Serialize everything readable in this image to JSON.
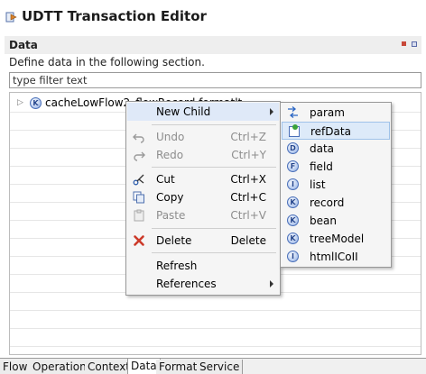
{
  "window": {
    "title": "UDTT Transaction Editor",
    "icon": "transaction-editor-icon"
  },
  "section": {
    "title": "Data",
    "description": "Define data in the following section."
  },
  "filter": {
    "placeholder": "type filter text"
  },
  "tree": {
    "node_label": "cacheLowFlow2_flowRecord.formatlt",
    "node_icon": "k-icon"
  },
  "context_menu": {
    "items": [
      {
        "label": "New Child",
        "accel": "",
        "icon": "",
        "has_submenu": true,
        "disabled": false
      },
      {
        "label": "Undo",
        "accel": "Ctrl+Z",
        "icon": "undo-icon",
        "disabled": true
      },
      {
        "label": "Redo",
        "accel": "Ctrl+Y",
        "icon": "redo-icon",
        "disabled": true
      },
      {
        "label": "Cut",
        "accel": "Ctrl+X",
        "icon": "cut-icon",
        "disabled": false
      },
      {
        "label": "Copy",
        "accel": "Ctrl+C",
        "icon": "copy-icon",
        "disabled": false
      },
      {
        "label": "Paste",
        "accel": "Ctrl+V",
        "icon": "paste-icon",
        "disabled": true
      },
      {
        "label": "Delete",
        "accel": "Delete",
        "icon": "delete-icon",
        "disabled": false
      },
      {
        "label": "Refresh",
        "accel": "",
        "icon": "",
        "disabled": false
      },
      {
        "label": "References",
        "accel": "",
        "icon": "",
        "has_submenu": true,
        "disabled": false
      }
    ]
  },
  "submenu": {
    "highlighted": "refData",
    "items": [
      {
        "label": "param",
        "icon": "param-icon",
        "letter": ""
      },
      {
        "label": "refData",
        "icon": "refdata-icon",
        "letter": ""
      },
      {
        "label": "data",
        "icon": "d-icon",
        "letter": "D"
      },
      {
        "label": "field",
        "icon": "f-icon",
        "letter": "F"
      },
      {
        "label": "list",
        "icon": "i-icon",
        "letter": "I"
      },
      {
        "label": "record",
        "icon": "k-icon",
        "letter": "K"
      },
      {
        "label": "bean",
        "icon": "k-icon",
        "letter": "K"
      },
      {
        "label": "treeModel",
        "icon": "k-icon",
        "letter": "K"
      },
      {
        "label": "htmlICoII",
        "icon": "i-icon",
        "letter": "I"
      }
    ]
  },
  "tabs": [
    {
      "label": "Flow",
      "active": false
    },
    {
      "label": "Operation",
      "active": false
    },
    {
      "label": "Context",
      "active": false
    },
    {
      "label": "Data",
      "active": true
    },
    {
      "label": "Format",
      "active": false
    },
    {
      "label": "Service",
      "active": false
    }
  ],
  "colors": {
    "accent": "#4b70b9",
    "highlight": "#ddeaf9",
    "delete_red": "#cc3a2a"
  }
}
